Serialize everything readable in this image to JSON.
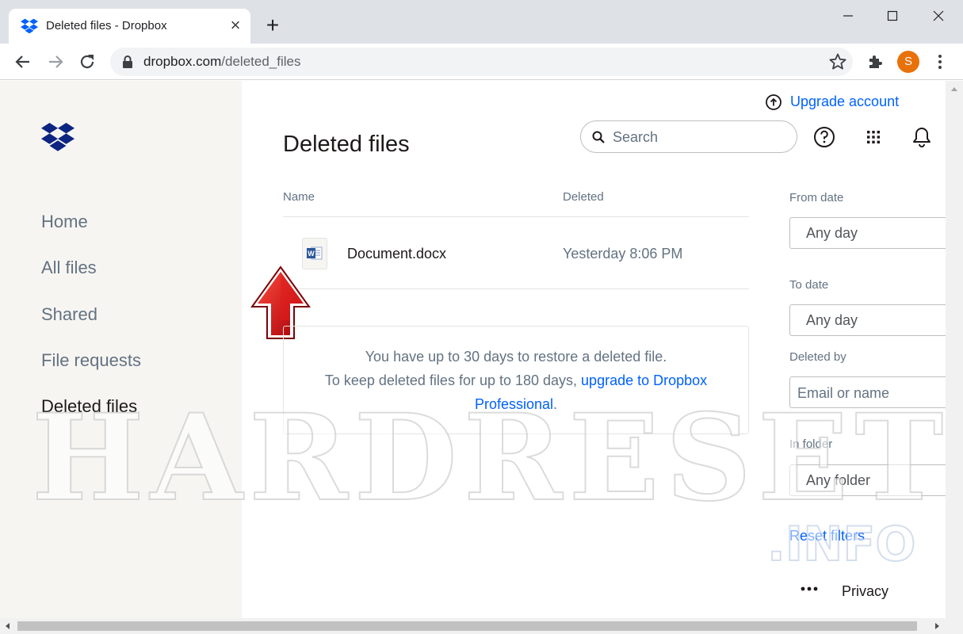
{
  "browser": {
    "tab_title": "Deleted files - Dropbox",
    "url_host": "dropbox.com",
    "url_path": "/deleted_files",
    "profile_initial": "S"
  },
  "sidebar": {
    "items": [
      {
        "label": "Home"
      },
      {
        "label": "All files"
      },
      {
        "label": "Shared"
      },
      {
        "label": "File requests"
      },
      {
        "label": "Deleted files",
        "active": true
      }
    ]
  },
  "header": {
    "upgrade_label": "Upgrade account",
    "page_title": "Deleted files",
    "search_placeholder": "Search"
  },
  "table": {
    "columns": [
      "Name",
      "Deleted"
    ],
    "rows": [
      {
        "name": "Document.docx",
        "deleted": "Yesterday 8:06 PM",
        "icon": "word-document-icon"
      }
    ]
  },
  "notice": {
    "line1": "You have up to 30 days to restore a deleted file.",
    "line2": "To keep deleted files for up to 180 days, ",
    "link": "upgrade to Dropbox Professional",
    "end": "."
  },
  "filters": {
    "from_date_label": "From date",
    "from_date_value": "Any day",
    "to_date_label": "To date",
    "to_date_value": "Any day",
    "deleted_by_label": "Deleted by",
    "deleted_by_placeholder": "Email or name",
    "in_folder_label": "In folder",
    "in_folder_value": "Any folder",
    "reset_label": "Reset filters"
  },
  "footer": {
    "privacy_label": "Privacy"
  },
  "watermark": {
    "main": "HARDRESET",
    "sub": ".INFO"
  },
  "colors": {
    "accent": "#0061fe",
    "sidebar_bg": "#f7f5f2",
    "dropbox_blue": "#0d2481",
    "profile": "#e8710a",
    "arrow_red": "#d3000a"
  }
}
